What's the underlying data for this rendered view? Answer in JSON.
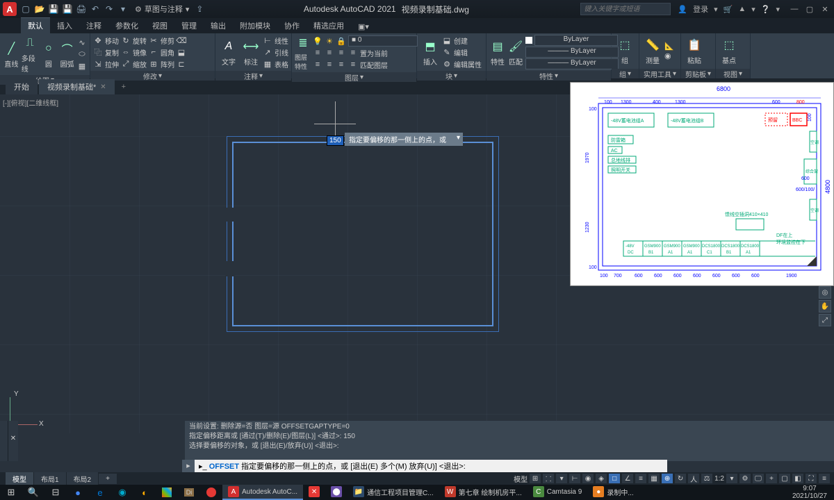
{
  "titlebar": {
    "logo": "A",
    "workspace": "草图与注释",
    "app": "Autodesk AutoCAD 2021",
    "file": "视频录制基础.dwg",
    "search_placeholder": "键入关键字或短语",
    "login": "登录"
  },
  "menutabs": [
    "默认",
    "插入",
    "注释",
    "参数化",
    "视图",
    "管理",
    "输出",
    "附加模块",
    "协作",
    "精选应用"
  ],
  "ribbon": {
    "draw": {
      "label": "绘图",
      "line": "直线",
      "pline": "多段线",
      "circle": "圆",
      "arc": "圆弧"
    },
    "modify": {
      "label": "修改",
      "move": "移动",
      "rotate": "旋转",
      "trim": "修剪",
      "copy": "复制",
      "mirror": "镜像",
      "fillet": "圆角",
      "stretch": "拉伸",
      "scale": "缩放",
      "array": "阵列"
    },
    "annot": {
      "label": "注释",
      "text": "文字",
      "dim": "标注",
      "linear": "线性",
      "leader": "引线",
      "table": "表格"
    },
    "layer": {
      "label": "图层",
      "props": "图层特性",
      "current": "0",
      "setcur": "置为当前",
      "match": "匹配图层"
    },
    "block": {
      "label": "块",
      "insert": "插入",
      "create": "创建",
      "edit": "编辑",
      "attedit": "编辑属性"
    },
    "props": {
      "label": "特性",
      "btn": "特性",
      "bylayer": "ByLayer",
      "match": "匹配"
    },
    "group": {
      "label": "组",
      "btn": "组"
    },
    "util": {
      "label": "实用工具",
      "measure": "测量"
    },
    "clip": {
      "label": "剪贴板",
      "paste": "粘贴"
    },
    "view": {
      "label": "视图",
      "base": "基点"
    }
  },
  "filetabs": {
    "start": "开始",
    "file": "视频录制基础*"
  },
  "canvas": {
    "viewport_label": "[-][俯视][二维线框]",
    "dim_value": "150",
    "tooltip": "指定要偏移的那一侧上的点，或"
  },
  "cmd": {
    "hist1": "当前设置: 删除源=否  图层=源  OFFSETGAPTYPE=0",
    "hist2": "指定偏移距离或 [通过(T)/删除(E)/图层(L)] <通过>:  150",
    "hist3": "选择要偏移的对象，或 [退出(E)/放弃(U)] <退出>:",
    "cmdname": "OFFSET",
    "cmdprompt": "指定要偏移的那一侧上的点，或 [退出(E) 多个(M) 放弃(U)] <退出>:"
  },
  "mltabs": [
    "模型",
    "布局1",
    "布局2"
  ],
  "statusbar": {
    "model": "模型",
    "scale": "1:2"
  },
  "taskbar": {
    "apps": [
      {
        "label": "Autodesk AutoC...",
        "color": "#d32f2f",
        "letter": "A",
        "active": true
      },
      {
        "label": "",
        "color": "#e53935",
        "letter": "●"
      },
      {
        "label": "",
        "color": "#6a4fa8",
        "letter": "⬤"
      },
      {
        "label": "通信工程项目管理C...",
        "color": "#2d4a6b",
        "letter": "📁"
      },
      {
        "label": "第七章 绘制机房平...",
        "color": "#c0392b",
        "letter": "W"
      },
      {
        "label": "Camtasia 9",
        "color": "#4a8a3f",
        "letter": "C"
      },
      {
        "label": "录制中...",
        "color": "#e67e22",
        "letter": "●"
      }
    ],
    "time": "9:07",
    "date": "2021/10/27"
  },
  "ref": {
    "top_dim": "6800",
    "right_dim": "4800",
    "top_dims": [
      "100",
      "1300",
      "400",
      "1300",
      "600",
      "800"
    ],
    "left_dims": [
      "100",
      "1970",
      "1230",
      "100"
    ],
    "right_dims": [
      "100",
      "600",
      "600/100/"
    ],
    "bottom_dims": [
      "100",
      "700",
      "600",
      "600",
      "600",
      "600",
      "600",
      "600",
      "600",
      "1900"
    ],
    "boxes": {
      "a": "-48V蓄电池组A",
      "b": "-48V蓄电池组B",
      "yl": "预留",
      "bbc": "BBC",
      "fl": "防雷箱",
      "ac": "AC",
      "gnd": "总地线排",
      "sw": "照明开关",
      "zhj": "综合架",
      "kt1": "空调",
      "kt2": "空调",
      "cable": "馈线空插洞410×410",
      "df1": "DF在上",
      "df2": "环境监控在下"
    },
    "rack": [
      "-48V",
      "GSM900",
      "GSM900",
      "GSM900",
      "DCS1800",
      "DCS1800",
      "DCS1800"
    ],
    "rack2": [
      "DC",
      "B1",
      "A1",
      "A1",
      "C1",
      "B1",
      "A1"
    ]
  }
}
